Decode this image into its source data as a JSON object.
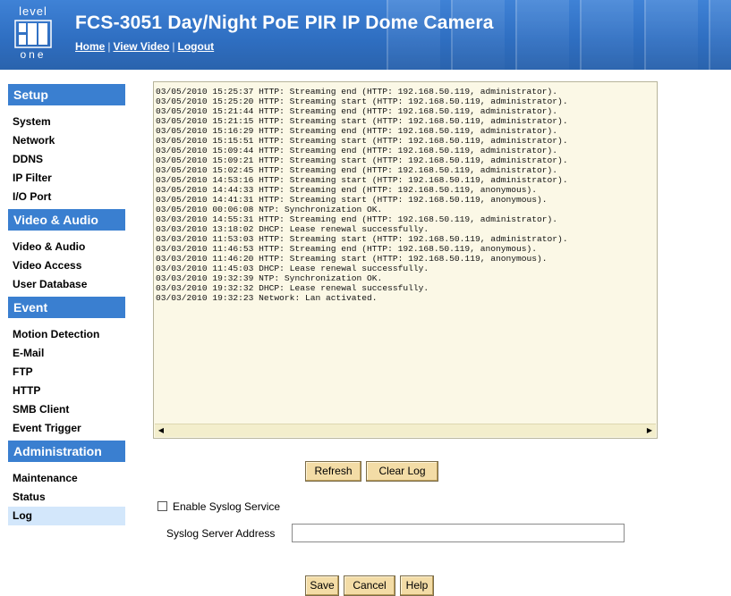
{
  "header": {
    "logo_top": "level",
    "logo_bottom": "one",
    "title": "FCS-3051 Day/Night PoE PIR IP Dome Camera",
    "links": [
      "Home",
      "View Video",
      "Logout"
    ],
    "separator": "|"
  },
  "sidebar": {
    "sections": [
      {
        "title": "Setup",
        "items": [
          "System",
          "Network",
          "DDNS",
          "IP Filter",
          "I/O Port"
        ]
      },
      {
        "title": "Video & Audio",
        "items": [
          "Video & Audio",
          "Video Access",
          "User Database"
        ]
      },
      {
        "title": "Event",
        "items": [
          "Motion Detection",
          "E-Mail",
          "FTP",
          "HTTP",
          "SMB Client",
          "Event Trigger"
        ]
      },
      {
        "title": "Administration",
        "items": [
          "Maintenance",
          "Status",
          "Log"
        ]
      }
    ],
    "active_item": "Log"
  },
  "log": {
    "lines": [
      "03/05/2010 15:25:37 HTTP: Streaming end (HTTP: 192.168.50.119, administrator).",
      "03/05/2010 15:25:20 HTTP: Streaming start (HTTP: 192.168.50.119, administrator).",
      "03/05/2010 15:21:44 HTTP: Streaming end (HTTP: 192.168.50.119, administrator).",
      "03/05/2010 15:21:15 HTTP: Streaming start (HTTP: 192.168.50.119, administrator).",
      "03/05/2010 15:16:29 HTTP: Streaming end (HTTP: 192.168.50.119, administrator).",
      "03/05/2010 15:15:51 HTTP: Streaming start (HTTP: 192.168.50.119, administrator).",
      "03/05/2010 15:09:44 HTTP: Streaming end (HTTP: 192.168.50.119, administrator).",
      "03/05/2010 15:09:21 HTTP: Streaming start (HTTP: 192.168.50.119, administrator).",
      "03/05/2010 15:02:45 HTTP: Streaming end (HTTP: 192.168.50.119, administrator).",
      "03/05/2010 14:53:16 HTTP: Streaming start (HTTP: 192.168.50.119, administrator).",
      "03/05/2010 14:44:33 HTTP: Streaming end (HTTP: 192.168.50.119, anonymous).",
      "03/05/2010 14:41:31 HTTP: Streaming start (HTTP: 192.168.50.119, anonymous).",
      "03/05/2010 00:06:08 NTP: Synchronization OK.",
      "03/03/2010 14:55:31 HTTP: Streaming end (HTTP: 192.168.50.119, administrator).",
      "03/03/2010 13:18:02 DHCP: Lease renewal successfully.",
      "03/03/2010 11:53:03 HTTP: Streaming start (HTTP: 192.168.50.119, administrator).",
      "03/03/2010 11:46:53 HTTP: Streaming end (HTTP: 192.168.50.119, anonymous).",
      "03/03/2010 11:46:20 HTTP: Streaming start (HTTP: 192.168.50.119, anonymous).",
      "03/03/2010 11:45:03 DHCP: Lease renewal successfully.",
      "03/03/2010 19:32:39 NTP: Synchronization OK.",
      "03/03/2010 19:32:32 DHCP: Lease renewal successfully.",
      "03/03/2010 19:32:23 Network: Lan activated."
    ]
  },
  "buttons": {
    "refresh": "Refresh",
    "clear_log": "Clear Log",
    "save": "Save",
    "cancel": "Cancel",
    "help": "Help"
  },
  "syslog": {
    "enable_label": "Enable Syslog Service",
    "enable_checked": false,
    "server_label": "Syslog Server Address",
    "server_value": ""
  },
  "colors": {
    "header_blue": "#2f6fc2",
    "section_blue": "#3a7fd0",
    "active_item_bg": "#d3e7fb",
    "log_bg": "#fbf8e6",
    "button_bg": "#f3dca6"
  },
  "icons": {
    "scroll_left": "left-arrow-icon",
    "scroll_right": "right-arrow-icon"
  }
}
